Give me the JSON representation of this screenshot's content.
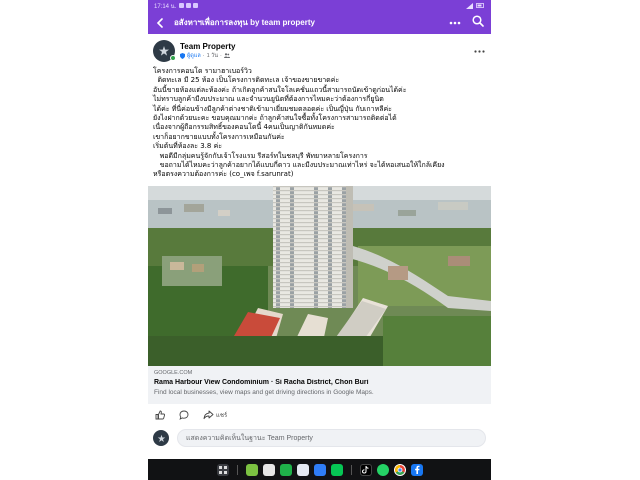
{
  "status_bar": {
    "time": "17:14 น.",
    "battery": "•"
  },
  "header": {
    "title": "อสังหาฯเพื่อการลงทุน  by team property"
  },
  "post": {
    "page_name": "Team Property",
    "role": "ผู้ดูแล",
    "age": "1 วัน",
    "text": "โครงการคอนโด รามาฮาเบอร์วิว\n  ติดทะเล มี 25 ห้อง เป็นโครงการติดทะเล เจ้าของขายขาดค่ะ\nอันนี้ขายห้องแต่ละห้องค่ะ ถ้าเกิดลูกค้าสนใจโลเคชั่นแถวนี้สามารถนัดเข้าดูก่อนได้ค่ะ\nไม่ทราบลูกค้ามีงบประมาณ และจำนวนยูนิตที่ต้องการไหมคะว่าต้องการกี่ยูนิต\nได้ค่ะ ที่นี่ค่อนข้างมีลูกค้าต่างชาติเข้ามาเยี่ยมชมตลอดค่ะ เป็นญี่ปุ่น กับเกาหลีค่ะ\nยังไงฝากด้วยนะคะ ขอบคุณมากค่ะ ถ้าลูกค้าสนใจซื้อทั้งโครงการสามารถติดต่อได้\nเนื่องจากผู้ถือกรรมสิทธิ์ของคอนโดนี้ 4คนเป็นญาติกันหมดค่ะ\nเขาก็อยากขายแบบทั้งโครงการเหมือนกันค่ะ\nเริ่มต้นที่ห้องละ 3.8 ค่ะ\n   พอดีมีกลุ่มคนรู้จักกับเจ้าโรงแรม รีสอร์ทในชลบุรี พัทยาหลายโครงการ\n   ขอถามได้ไหมคะว่าลูกค้าอยากได้แบบกี่ดาว และมีงบประมาณเท่าไหร่ จะได้หอเสนอให้ใกล้เคียง\nหรือตรงความต้องการค่ะ (co_เพจ f.sarunrat)"
  },
  "link": {
    "domain": "GOOGLE.COM",
    "title": "Rama Harbour View Condominium · Si Racha District, Chon Buri",
    "description": "Find local businesses, view maps and get driving directions in Google Maps."
  },
  "actions": {
    "share": "แชร์"
  },
  "comment": {
    "placeholder": "แสดงความคิดเห็นในฐานะ Team Property"
  },
  "colors": {
    "accent": "#7b3fd6",
    "link_bg": "#f0f2f5"
  },
  "icons": {
    "back": "arrow-left-icon",
    "more": "more-dots-icon",
    "search": "search-icon",
    "like": "thumbs-up-icon",
    "comment": "comment-bubble-icon",
    "share": "share-arrow-icon"
  }
}
